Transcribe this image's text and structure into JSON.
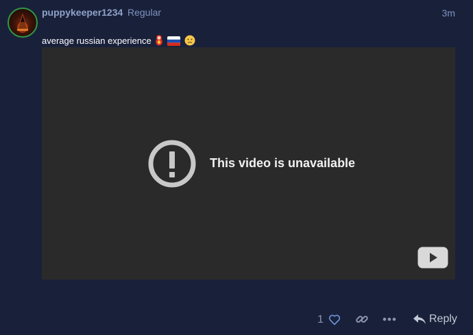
{
  "post": {
    "username": "puppykeeper1234",
    "user_title": "Regular",
    "time_ago": "3m",
    "text": "average russian experience",
    "emojis": [
      "matryoshka-doll-icon",
      "russia-flag-icon",
      "slightly-frowning-face-icon"
    ]
  },
  "video": {
    "message": "This video is unavailable",
    "state_icon": "alert-circle-icon",
    "player_icon": "youtube-play-icon"
  },
  "actions": {
    "like_count": "1",
    "reply_label": "Reply",
    "icons": [
      "heart-icon",
      "link-icon",
      "more-dots-icon",
      "reply-arrow-icon"
    ]
  },
  "colors": {
    "background": "#19213a",
    "username": "#8fa2c8",
    "video_bg": "#2a2a2a",
    "muted": "#8b96ad",
    "accent": "#6f8fd6"
  }
}
